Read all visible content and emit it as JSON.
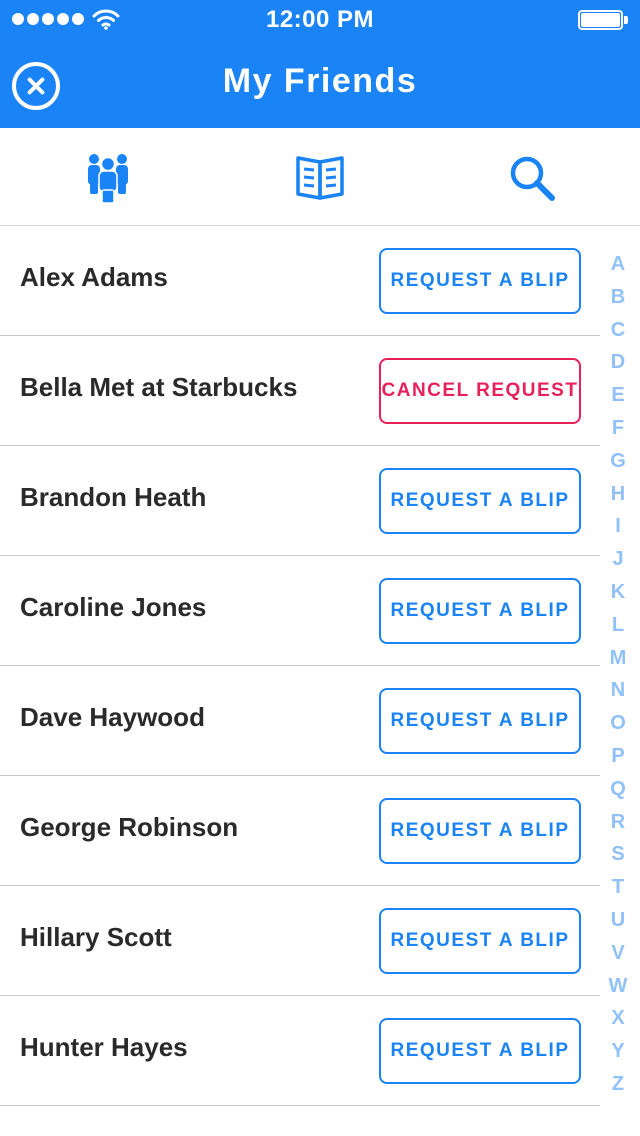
{
  "status_bar": {
    "time": "12:00 PM",
    "signal_icon": "signal-dots-icon",
    "wifi_icon": "wifi-icon",
    "battery_icon": "battery-icon"
  },
  "nav": {
    "title": "My Friends",
    "close_icon": "close-circle-icon"
  },
  "tabs": [
    {
      "name": "friends",
      "icon": "friends-group-icon"
    },
    {
      "name": "book",
      "icon": "open-book-icon"
    },
    {
      "name": "search",
      "icon": "search-icon"
    }
  ],
  "friends": [
    {
      "name": "Alex Adams",
      "action": "REQUEST A BLIP",
      "state": "request"
    },
    {
      "name": "Bella Met at Starbucks",
      "action": "CANCEL REQUEST",
      "state": "cancel"
    },
    {
      "name": "Brandon Heath",
      "action": "REQUEST A BLIP",
      "state": "request"
    },
    {
      "name": "Caroline Jones",
      "action": "REQUEST A BLIP",
      "state": "request"
    },
    {
      "name": "Dave Haywood",
      "action": "REQUEST A BLIP",
      "state": "request"
    },
    {
      "name": "George Robinson",
      "action": "REQUEST A BLIP",
      "state": "request"
    },
    {
      "name": "Hillary Scott",
      "action": "REQUEST A BLIP",
      "state": "request"
    },
    {
      "name": "Hunter Hayes",
      "action": "REQUEST A BLIP",
      "state": "request"
    }
  ],
  "alphabet": [
    "A",
    "B",
    "C",
    "D",
    "E",
    "F",
    "G",
    "H",
    "I",
    "J",
    "K",
    "L",
    "M",
    "N",
    "O",
    "P",
    "Q",
    "R",
    "S",
    "T",
    "U",
    "V",
    "W",
    "X",
    "Y",
    "Z"
  ],
  "colors": {
    "brand_blue": "#1a83f5",
    "cancel_red": "#e8215a",
    "index_blue": "#90c1f8",
    "text_dark": "#2a2a2a"
  }
}
